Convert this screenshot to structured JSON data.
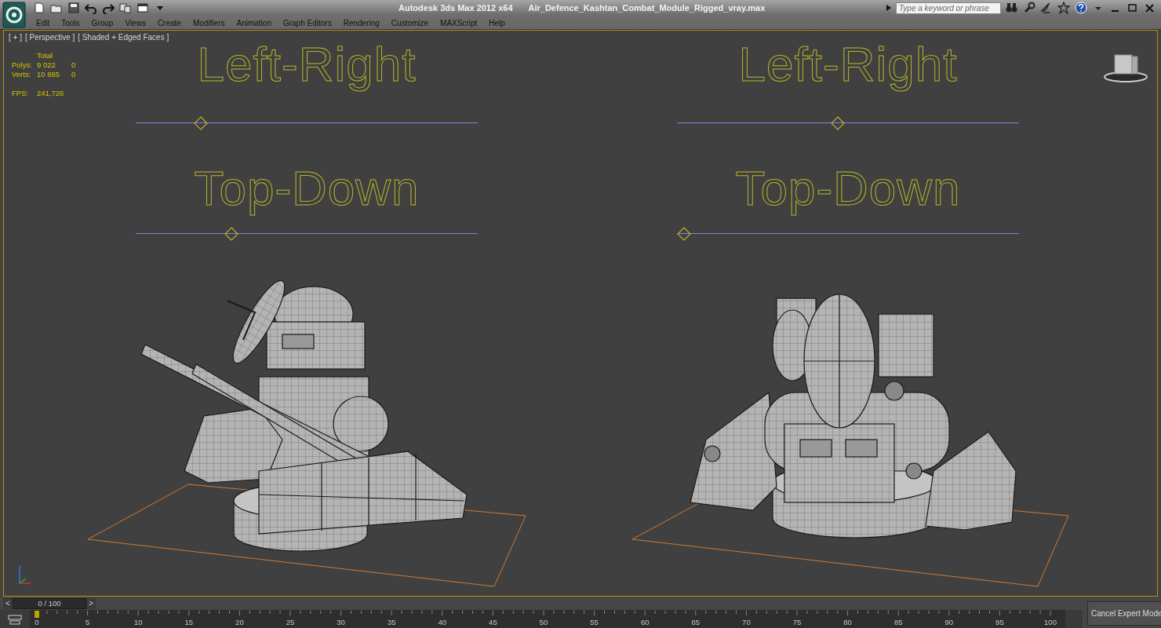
{
  "title_bar": {
    "app_title": "Autodesk 3ds Max  2012 x64",
    "file_name": "Air_Defence_Kashtan_Combat_Module_Rigged_vray.max"
  },
  "search": {
    "placeholder": "Type a keyword or phrase"
  },
  "menu": [
    "Edit",
    "Tools",
    "Group",
    "Views",
    "Create",
    "Modifiers",
    "Animation",
    "Graph Editors",
    "Rendering",
    "Customize",
    "MAXScript",
    "Help"
  ],
  "viewport": {
    "labels": [
      "[ + ]",
      "[ Perspective ]",
      "[ Shaded + Edged Faces ]"
    ],
    "stats": {
      "header": "Total",
      "rows": [
        {
          "label": "Polys:",
          "total": "9 022",
          "selected": "0"
        },
        {
          "label": "Verts:",
          "total": "10 885",
          "selected": "0"
        }
      ],
      "fps_label": "FPS:",
      "fps": "241,726"
    },
    "panels": [
      {
        "controls": [
          {
            "label": "Left-Right",
            "level": 0.19
          },
          {
            "label": "Top-Down",
            "level": 0.28
          }
        ]
      },
      {
        "controls": [
          {
            "label": "Left-Right",
            "level": 0.47
          },
          {
            "label": "Top-Down",
            "level": 0.02
          }
        ]
      }
    ]
  },
  "time_slider": {
    "prev": "<",
    "frame": "0 / 100",
    "next": ">",
    "level": 0
  },
  "track_bar": {
    "ticks": [
      "0",
      "5",
      "10",
      "15",
      "20",
      "25",
      "30",
      "35",
      "40",
      "45",
      "50",
      "55",
      "60",
      "65",
      "70",
      "75",
      "80",
      "85",
      "90",
      "95",
      "100"
    ]
  },
  "expert_mode_button": "Cancel Expert Mode"
}
